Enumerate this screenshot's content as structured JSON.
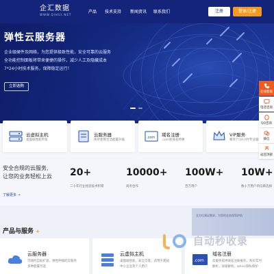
{
  "header": {
    "logo_main": "企汇数据",
    "logo_sub": "WWW.QIHUI.NET",
    "nav": [
      "产品",
      "技术支持",
      "新闻资讯",
      "联系我们"
    ],
    "register_label": "注册",
    "login_label": "登录/注册"
  },
  "hero": {
    "title": "弹性云服务器",
    "lines": [
      "企业级硬件及网络，为您提供极致性能，安全可靠的云服务",
      "全功能控制面板将带来便捷的操作，减少人工及隐藏成本",
      "7*24小时技术服务，保障稳定运行！"
    ],
    "button": "立即选购"
  },
  "sidebar": [
    {
      "label": "在线客服",
      "icon": "phone-icon"
    },
    {
      "label": "电话咨询",
      "icon": "chat-icon"
    },
    {
      "label": "QQ咨询",
      "icon": "qq-icon"
    },
    {
      "label": "微信",
      "icon": "wechat-icon"
    },
    {
      "label": "返回顶部",
      "icon": "top-icon"
    }
  ],
  "cards": [
    {
      "title": "云虚拟主机",
      "desc": "桌面级性能带宽",
      "icon": "server-icon"
    },
    {
      "title": "云服务器",
      "desc": "简单使用灵活配置升级",
      "icon": "cloud-server-icon"
    },
    {
      "title": "域名注册",
      "desc": ".com新域名特惠",
      "icon": "domain-icon"
    },
    {
      "title": "VIP服务",
      "desc": "尊享7*24小时专业服务",
      "icon": "vip-crown-icon"
    }
  ],
  "slogan": [
    "安全合规的云服务,",
    "让您的业务轻松上云"
  ],
  "more": "了解更多 →",
  "stats": [
    {
      "num": "20+",
      "sub": "二十年行业经验技术积累"
    },
    {
      "num": "10000+",
      "sub": "商务合作"
    },
    {
      "num": "100W+",
      "sub": "百万用户"
    },
    {
      "num": "10W+",
      "sub": "数十万用户的信赖选择"
    }
  ],
  "section_title": "产品与服务",
  "banner_text": "全方位满足需求，为您的业务保驾护航",
  "watermark": "自动秒收录",
  "products": [
    {
      "title": "云服务器",
      "lines": [
        "可随时自助扩容，弹性伸缩的云服务",
        "多种配置可选"
      ]
    },
    {
      "title": "云虚拟主机",
      "lines": [
        "桌面级性能，安全可靠，适用于建站",
        "中小企业及个人用户"
      ]
    },
    {
      "title": "域名注册",
      "lines": [
        "云服务提供域名注册服务，购买实时",
        "解析，快速解析，whois隐私保护"
      ]
    }
  ],
  "colors": {
    "hero": "#13287f",
    "accent": "#f39a1f",
    "sidebar_first": "#f15b1e"
  }
}
